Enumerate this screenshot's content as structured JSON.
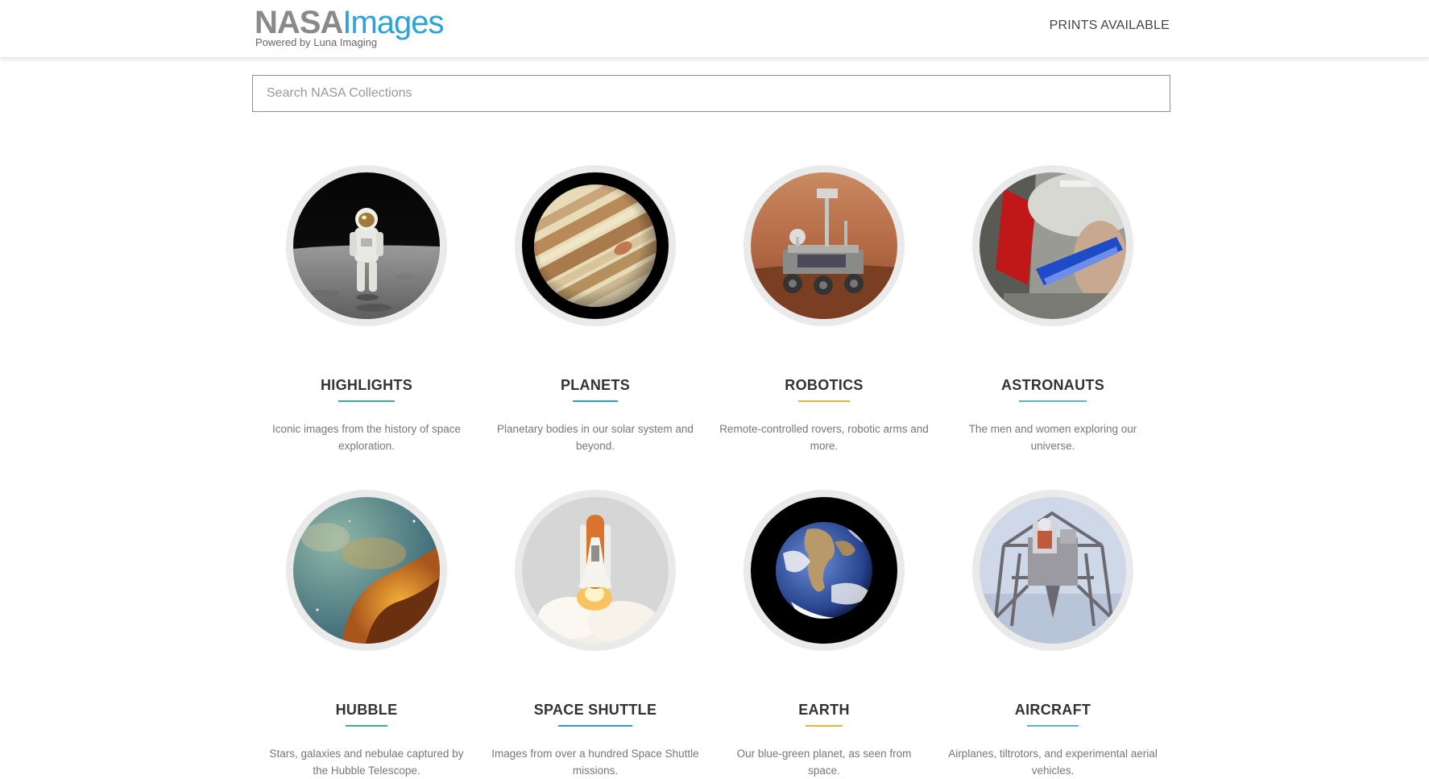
{
  "header": {
    "logo_nasa": "NASA",
    "logo_images": "Images",
    "logo_sub": "Powered by Luna Imaging",
    "prints_link": "PRINTS AVAILABLE"
  },
  "search": {
    "placeholder": "Search NASA Collections",
    "value": ""
  },
  "collections": [
    {
      "title": "HIGHLIGHTS",
      "description": "Iconic images from the history of space exploration.",
      "icon": "astronaut-moon-image",
      "accent": "#3bb08f"
    },
    {
      "title": "PLANETS",
      "description": "Planetary bodies in our solar system and beyond.",
      "icon": "jupiter-image",
      "accent": "#2a9fc9"
    },
    {
      "title": "ROBOTICS",
      "description": "Remote-controlled rovers, robotic arms and more.",
      "icon": "mars-rover-image",
      "accent": "#e6b53c"
    },
    {
      "title": "ASTRONAUTS",
      "description": "The men and women exploring our universe.",
      "icon": "astronaut-helmet-image",
      "accent": "#5bb4d8"
    },
    {
      "title": "HUBBLE",
      "description": "Stars, galaxies and nebulae captured by the Hubble Telescope.",
      "icon": "nebula-image",
      "accent": "#3bb08f"
    },
    {
      "title": "SPACE SHUTTLE",
      "description": "Images from over a hundred Space Shuttle missions.",
      "icon": "shuttle-launch-image",
      "accent": "#2a9fc9"
    },
    {
      "title": "EARTH",
      "description": "Our blue-green planet, as seen from space.",
      "icon": "earth-image",
      "accent": "#e6b53c"
    },
    {
      "title": "AIRCRAFT",
      "description": "Airplanes, tiltrotors, and experimental aerial vehicles.",
      "icon": "lunar-landing-vehicle-image",
      "accent": "#5bb4d8"
    }
  ]
}
